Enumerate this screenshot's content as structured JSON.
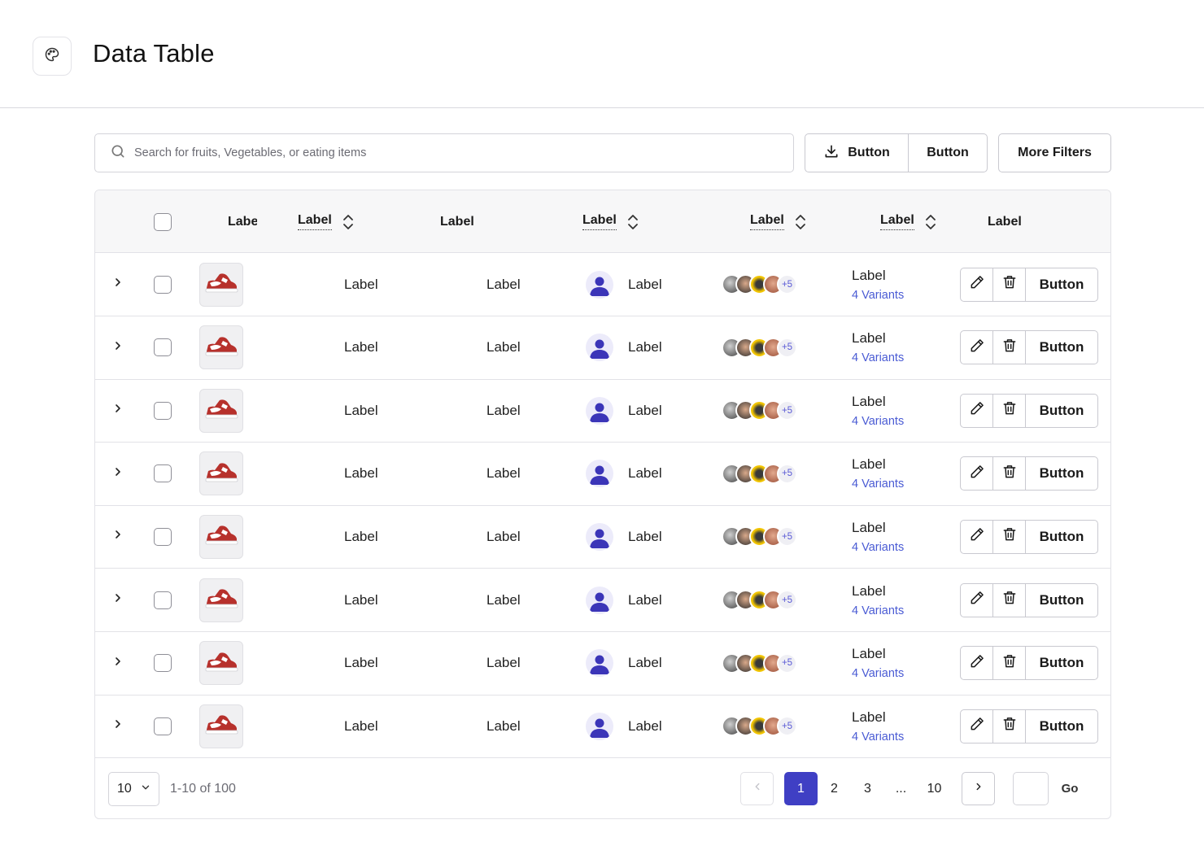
{
  "header": {
    "title": "Data Table",
    "logo_icon": "palette-icon"
  },
  "toolbar": {
    "search_placeholder": "Search for fruits, Vegetables, or eating items",
    "download_button_label": "Button",
    "second_button_label": "Button",
    "more_filters_label": "More Filters"
  },
  "table": {
    "columns": [
      {
        "label": "Label",
        "sortable": false
      },
      {
        "label": "Label",
        "sortable": true
      },
      {
        "label": "Label",
        "sortable": false
      },
      {
        "label": "Label",
        "sortable": true
      },
      {
        "label": "Label",
        "sortable": true
      },
      {
        "label": "Label",
        "sortable": true
      },
      {
        "label": "Label",
        "sortable": false
      }
    ],
    "rows": [
      {
        "col1": "Label",
        "col2": "Label",
        "user": "Label",
        "more_count": "+5",
        "variant_label": "Label",
        "variant_link": "4 Variants",
        "action_label": "Button"
      },
      {
        "col1": "Label",
        "col2": "Label",
        "user": "Label",
        "more_count": "+5",
        "variant_label": "Label",
        "variant_link": "4 Variants",
        "action_label": "Button"
      },
      {
        "col1": "Label",
        "col2": "Label",
        "user": "Label",
        "more_count": "+5",
        "variant_label": "Label",
        "variant_link": "4 Variants",
        "action_label": "Button"
      },
      {
        "col1": "Label",
        "col2": "Label",
        "user": "Label",
        "more_count": "+5",
        "variant_label": "Label",
        "variant_link": "4 Variants",
        "action_label": "Button"
      },
      {
        "col1": "Label",
        "col2": "Label",
        "user": "Label",
        "more_count": "+5",
        "variant_label": "Label",
        "variant_link": "4 Variants",
        "action_label": "Button"
      },
      {
        "col1": "Label",
        "col2": "Label",
        "user": "Label",
        "more_count": "+5",
        "variant_label": "Label",
        "variant_link": "4 Variants",
        "action_label": "Button"
      },
      {
        "col1": "Label",
        "col2": "Label",
        "user": "Label",
        "more_count": "+5",
        "variant_label": "Label",
        "variant_link": "4 Variants",
        "action_label": "Button"
      },
      {
        "col1": "Label",
        "col2": "Label",
        "user": "Label",
        "more_count": "+5",
        "variant_label": "Label",
        "variant_link": "4 Variants",
        "action_label": "Button"
      }
    ]
  },
  "pagination": {
    "page_size": "10",
    "range_text": "1-10 of 100",
    "pages": [
      "1",
      "2",
      "3",
      "...",
      "10"
    ],
    "active_page": "1",
    "go_label": "Go"
  },
  "colors": {
    "accent": "#3f3fc4",
    "link": "#4a5bd4",
    "product_red": "#b7312c"
  }
}
